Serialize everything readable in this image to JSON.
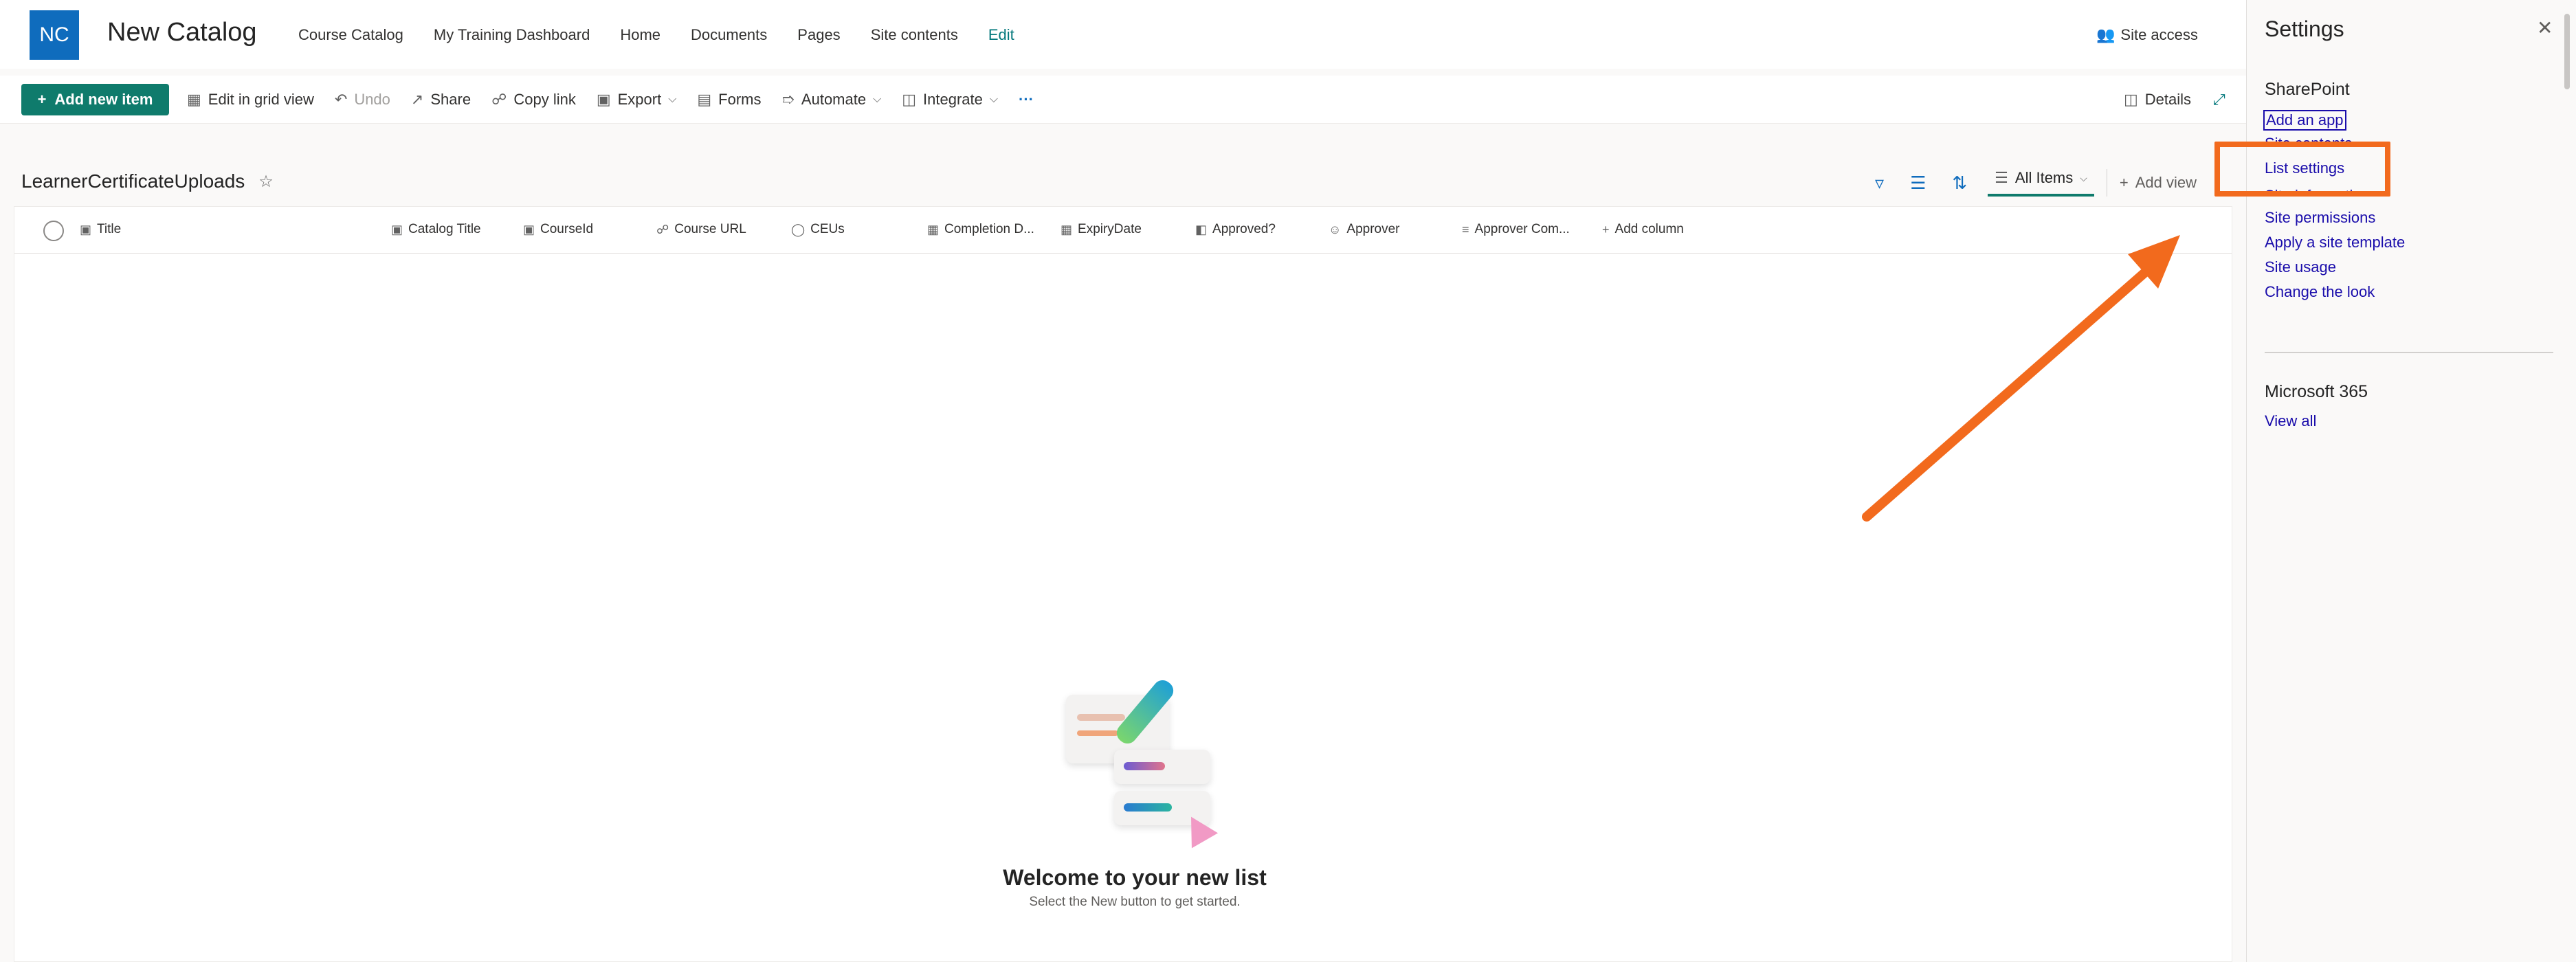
{
  "site": {
    "logo_initials": "NC",
    "title": "New Catalog",
    "nav": [
      "Course Catalog",
      "My Training Dashboard",
      "Home",
      "Documents",
      "Pages",
      "Site contents",
      "Edit"
    ],
    "site_access": "Site access"
  },
  "commandbar": {
    "new_item": "Add new item",
    "edit_grid": "Edit in grid view",
    "undo": "Undo",
    "share": "Share",
    "copy_link": "Copy link",
    "export": "Export",
    "forms": "Forms",
    "automate": "Automate",
    "integrate": "Integrate",
    "more": "···",
    "details": "Details"
  },
  "list": {
    "title": "LearnerCertificateUploads",
    "view_name": "All Items",
    "add_view": "Add view",
    "columns": [
      "Title",
      "Catalog Title",
      "CourseId",
      "Course URL",
      "CEUs",
      "Completion D...",
      "ExpiryDate",
      "Approved?",
      "Approver",
      "Approver Com...",
      "Add column"
    ],
    "empty_title": "Welcome to your new list",
    "empty_subtitle": "Select the New button to get started."
  },
  "settings_panel": {
    "title": "Settings",
    "sharepoint_heading": "SharePoint",
    "links": [
      "Add an app",
      "List settings",
      "Site permissions",
      "Apply a site template",
      "Site usage",
      "Change the look"
    ],
    "hidden_peek_1": "Site contents",
    "hidden_peek_2": "Site information",
    "m365_heading": "Microsoft 365",
    "m365_link": "View all"
  },
  "colors": {
    "accent": "#0f7b6c",
    "logo": "#0f6cbd",
    "annotation": "#f26a1d",
    "link": "#1a0dab"
  }
}
